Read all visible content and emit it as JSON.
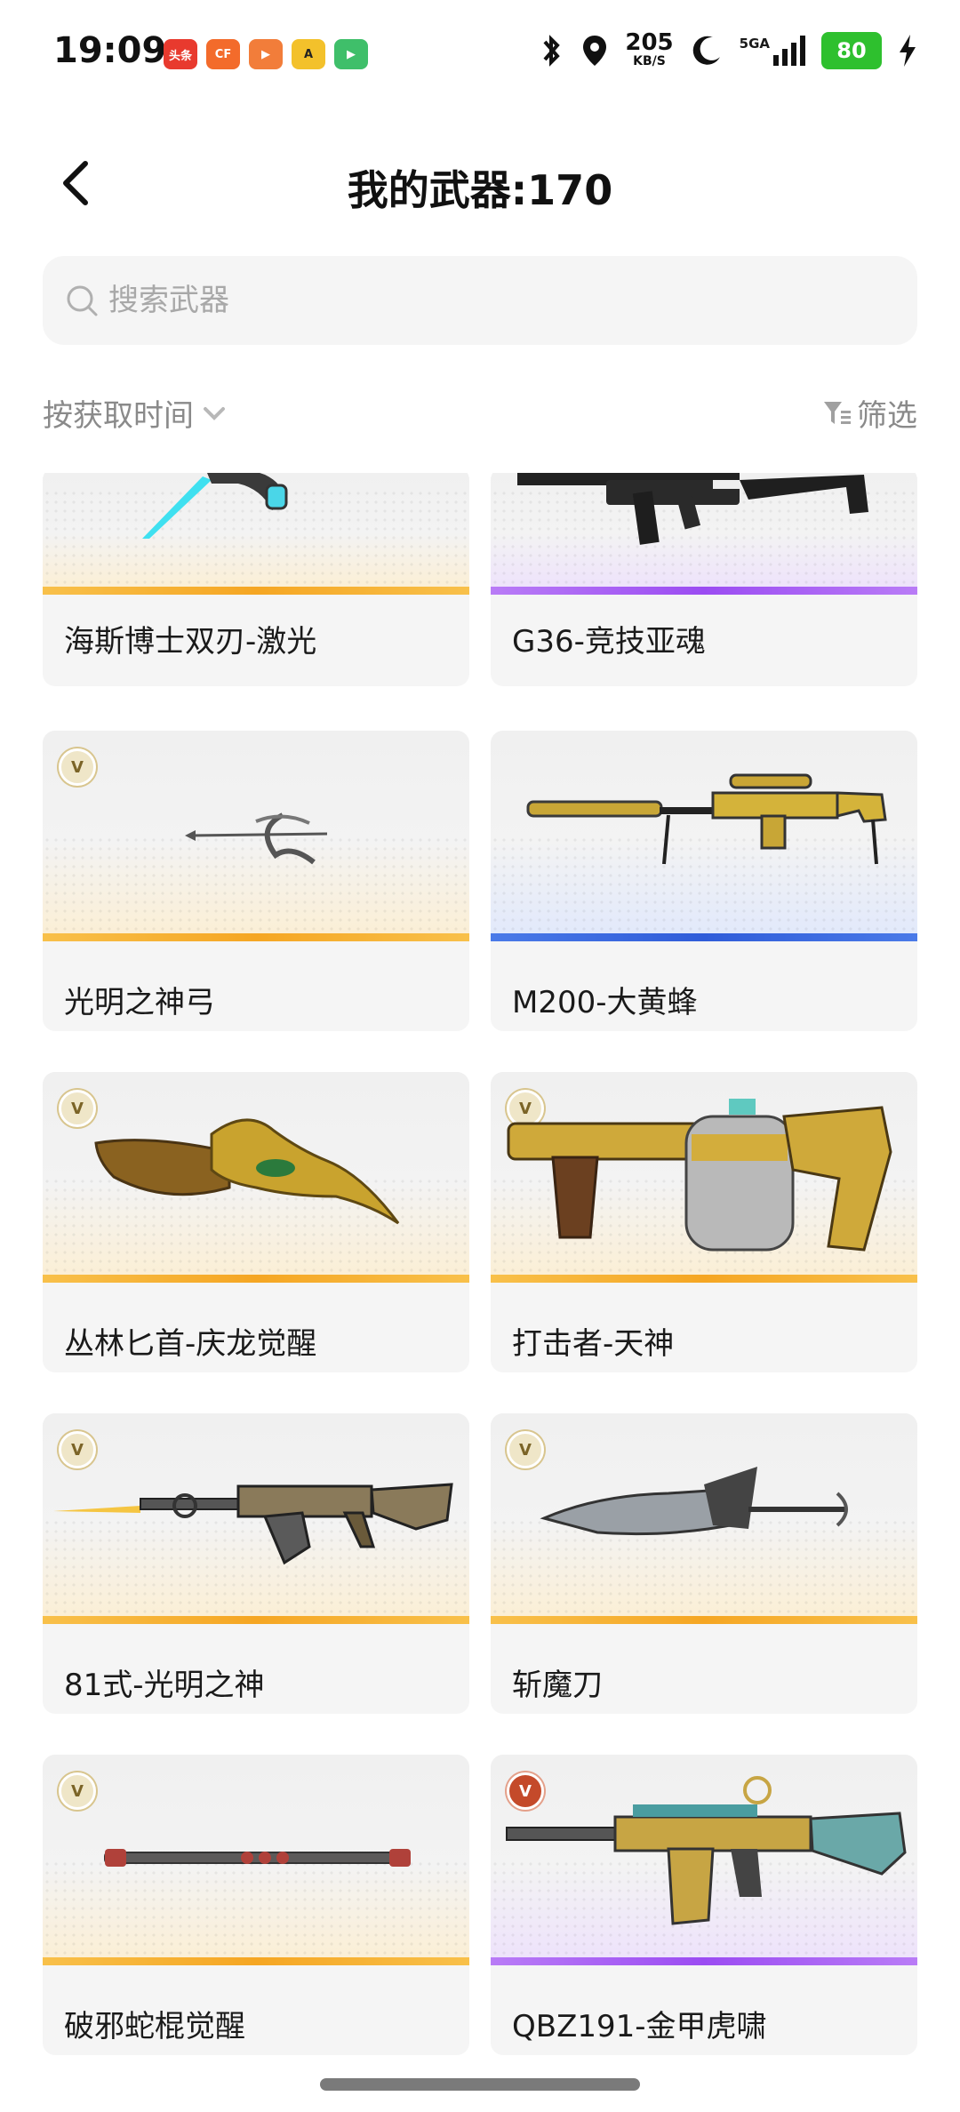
{
  "status_bar": {
    "time": "19:09",
    "apps": [
      {
        "icon": "toutiao-app-icon",
        "label": "头条",
        "color": "#e83a2e"
      },
      {
        "icon": "cf-app-icon",
        "label": "CF",
        "color": "#f36b2b"
      },
      {
        "icon": "game-app-icon",
        "label": "",
        "color": "#f27d3a"
      },
      {
        "icon": "a-app-icon",
        "label": "A",
        "color": "#f3c12b"
      },
      {
        "icon": "video-app-icon",
        "label": "",
        "color": "#3fbf6a"
      }
    ],
    "net_speed": "205",
    "net_unit": "KB/S",
    "network_type": "5GA",
    "battery": "80"
  },
  "header": {
    "title": "我的武器:170"
  },
  "search": {
    "placeholder": "搜索武器",
    "value": ""
  },
  "sort": {
    "label": "按获取时间"
  },
  "filter": {
    "label": "筛选"
  },
  "colors": {
    "orange_rarity": "#f5a623",
    "purple_rarity": "#a855f7",
    "blue_rarity": "#4a74e0",
    "card_bg": "#f5f5f5"
  },
  "weapons": [
    {
      "name": "海斯博士双刃-激光",
      "rarity": "orange",
      "badge": "",
      "icon": "dual-blade-weapon-icon"
    },
    {
      "name": "G36-竞技亚魂",
      "rarity": "purple",
      "badge": "",
      "icon": "rifle-weapon-icon"
    },
    {
      "name": "光明之神弓",
      "rarity": "orange",
      "badge": "V",
      "icon": "bow-weapon-icon"
    },
    {
      "name": "M200-大黄蜂",
      "rarity": "blue",
      "badge": "",
      "icon": "sniper-weapon-icon"
    },
    {
      "name": "丛林匕首-庆龙觉醒",
      "rarity": "orange",
      "badge": "V",
      "icon": "dragon-dagger-weapon-icon"
    },
    {
      "name": "打击者-天神",
      "rarity": "orange",
      "badge": "V",
      "icon": "drum-shotgun-weapon-icon"
    },
    {
      "name": "81式-光明之神",
      "rarity": "orange",
      "badge": "V",
      "icon": "assault-rifle-weapon-icon"
    },
    {
      "name": "斩魔刀",
      "rarity": "orange",
      "badge": "V",
      "icon": "demon-blade-weapon-icon"
    },
    {
      "name": "破邪蛇棍觉醒",
      "rarity": "orange",
      "badge": "V",
      "icon": "staff-weapon-icon"
    },
    {
      "name": "QBZ191-金甲虎啸",
      "rarity": "purple",
      "badge": "V",
      "icon": "qbz-rifle-weapon-icon"
    }
  ]
}
